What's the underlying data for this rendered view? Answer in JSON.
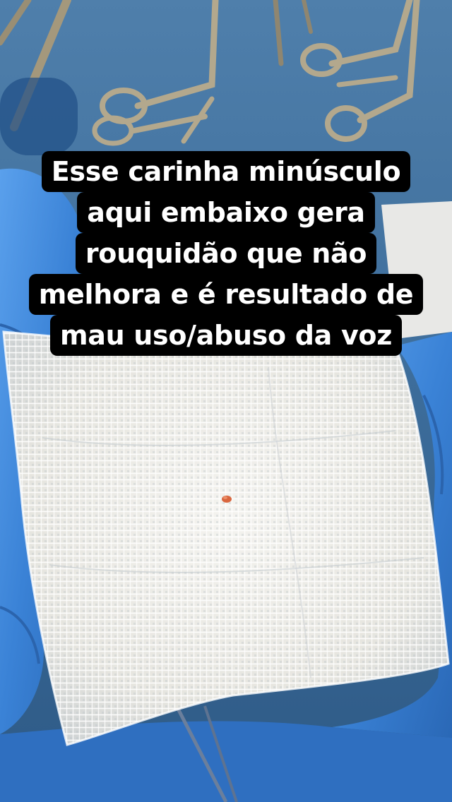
{
  "caption": {
    "lines": [
      "Esse carinha minúsculo",
      "aqui embaixo gera",
      "rouquidão que não",
      "melhora e é resultado de",
      "mau uso/abuso da voz"
    ]
  },
  "photo": {
    "subject": "gauze-with-small-specimen",
    "colors": {
      "background": "#2f5f8f",
      "glove": "#3b7fd6",
      "gauze": "#ecebe6",
      "specimen": "#d9663e",
      "caption_bg": "#000000",
      "caption_text": "#ffffff"
    }
  }
}
